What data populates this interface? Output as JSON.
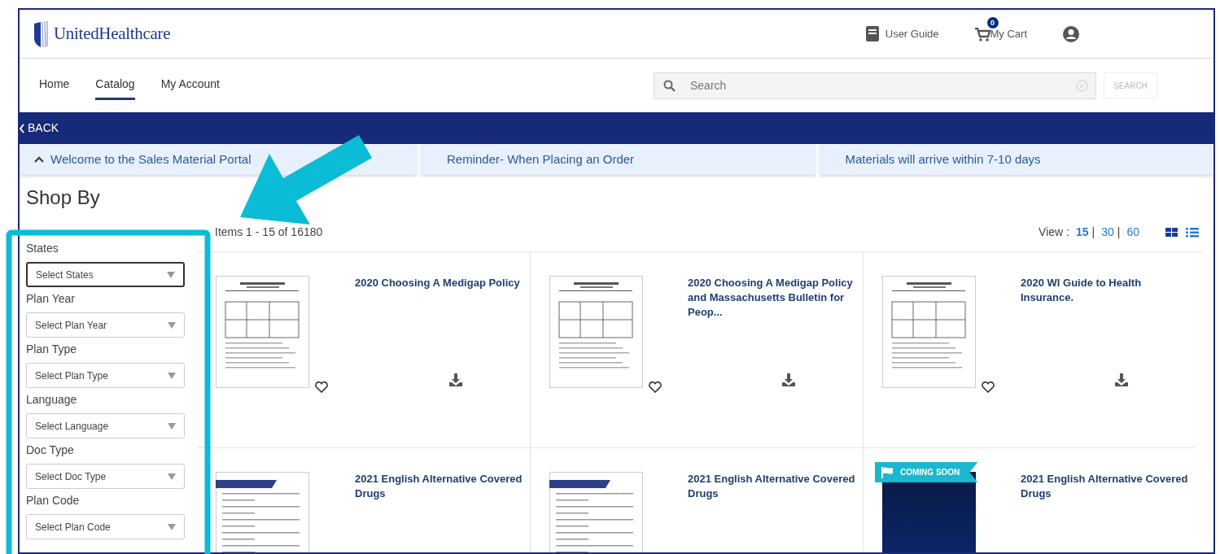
{
  "header": {
    "logo": "UnitedHealthcare",
    "user_guide": "User Guide",
    "cart": {
      "label": "My Cart",
      "count": "0"
    }
  },
  "nav": {
    "tabs": [
      {
        "label": "Home",
        "selected": false
      },
      {
        "label": "Catalog",
        "selected": true
      },
      {
        "label": "My Account",
        "selected": false
      }
    ],
    "search": {
      "placeholder": "Search",
      "button": "SEARCH"
    }
  },
  "band": {
    "back": "BACK"
  },
  "announcements": [
    {
      "text": "Welcome to the Sales Material Portal",
      "expanded": true
    },
    {
      "text": "Reminder- When Placing an Order"
    },
    {
      "text": "Materials will arrive within 7-10 days"
    }
  ],
  "heading": "Shop By",
  "filters": [
    {
      "label": "States",
      "placeholder": "Select States",
      "focused": true
    },
    {
      "label": "Plan Year",
      "placeholder": "Select Plan Year",
      "focused": false
    },
    {
      "label": "Plan Type",
      "placeholder": "Select Plan Type",
      "focused": false
    },
    {
      "label": "Language",
      "placeholder": "Select Language",
      "focused": false
    },
    {
      "label": "Doc Type",
      "placeholder": "Select Doc Type",
      "focused": false
    },
    {
      "label": "Plan Code",
      "placeholder": "Select Plan Code",
      "focused": false
    }
  ],
  "results": {
    "count": "Items 1 - 15 of 16180",
    "view_label": "View :",
    "separator": "|",
    "page_sizes": [
      {
        "label": "15",
        "selected": true
      },
      {
        "label": "30",
        "selected": false
      },
      {
        "label": "60",
        "selected": false
      }
    ],
    "view_modes": [
      {
        "kind": "grid",
        "selected": true
      },
      {
        "kind": "list",
        "selected": false
      }
    ]
  },
  "products": [
    {
      "title": "2020 Choosing A Medigap Policy",
      "kind": "table",
      "favorited": false,
      "downloadable": true
    },
    {
      "title": "2020 Choosing A Medigap Policy and Massachusetts Bulletin for Peop...",
      "kind": "table",
      "favorited": false,
      "downloadable": true
    },
    {
      "title": "2020 WI Guide to Health Insurance.",
      "kind": "table",
      "favorited": false,
      "downloadable": true
    },
    {
      "title": "2021 English Alternative Covered Drugs",
      "kind": "list"
    },
    {
      "title": "2021 English Alternative Covered Drugs",
      "kind": "list"
    },
    {
      "title": "2021 English Alternative Covered Drugs",
      "kind": "cover",
      "badge": "COMING SOON"
    }
  ]
}
